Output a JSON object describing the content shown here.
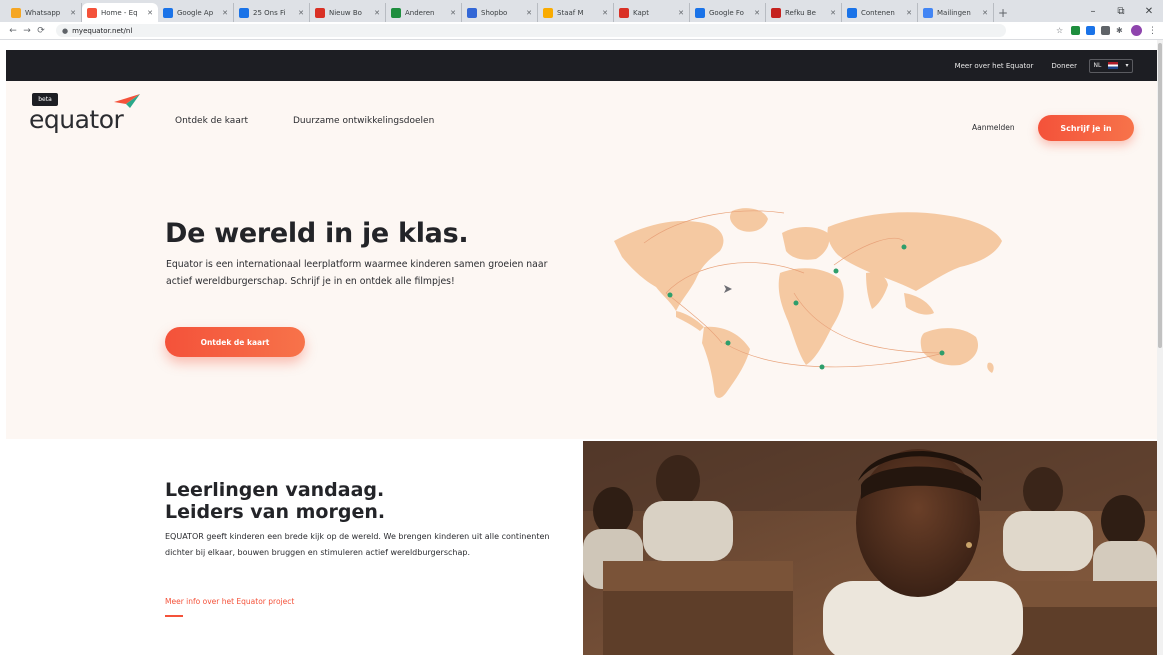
{
  "browser": {
    "tabs": [
      {
        "label": "Whatsapp",
        "color": "#f5a623"
      },
      {
        "label": "Home - Eq",
        "color": "#f4523a",
        "active": true
      },
      {
        "label": "Google Ap",
        "color": "#1a73e8"
      },
      {
        "label": "25 Ons Fi",
        "color": "#1a73e8"
      },
      {
        "label": "Nieuw Bo",
        "color": "#d93025"
      },
      {
        "label": "Anderen",
        "color": "#1e8e3e"
      },
      {
        "label": "Shopbo",
        "color": "#3367d6"
      },
      {
        "label": "Staaf M",
        "color": "#f9ab00"
      },
      {
        "label": "Kapt",
        "color": "#d93025"
      },
      {
        "label": "Google Fo",
        "color": "#1a73e8"
      },
      {
        "label": "Refku Be",
        "color": "#c5221f"
      },
      {
        "label": "Contenen",
        "color": "#1a73e8"
      },
      {
        "label": "Mailingen",
        "color": "#4285f4"
      }
    ],
    "url": "myequator.net/nl",
    "new_tab": "+",
    "window_controls": [
      "–",
      "⧉",
      "✕"
    ],
    "extension_colors": [
      "#1e8e3e",
      "#1a73e8",
      "#5f6368",
      "#5f6368"
    ]
  },
  "topbar": {
    "links": [
      "Meer over het Equator",
      "Doneer"
    ],
    "language": "NL"
  },
  "header": {
    "badge": "beta",
    "logo": "equator",
    "nav": [
      "Ontdek de kaart",
      "Duurzame ontwikkelingsdoelen"
    ],
    "login": "Aanmelden",
    "signup": "Schrijf je in"
  },
  "hero": {
    "title": "De wereld in je klas.",
    "text": "Equator is een internationaal leerplatform waarmee kinderen samen groeien naar actief wereldburgerschap. Schrijf je in en ontdek alle filmpjes!",
    "button": "Ontdek de kaart"
  },
  "section": {
    "title_line1": "Leerlingen vandaag.",
    "title_line2": "Leiders van morgen.",
    "text": "EQUATOR geeft kinderen een brede kijk op de wereld. We brengen kinderen uit alle continenten dichter bij elkaar, bouwen bruggen en stimuleren actief wereldburgerschap.",
    "link": "Meer info over het Equator project"
  },
  "colors": {
    "accent": "#f4523a",
    "map_land": "#f5c9a2",
    "map_marker": "#2e9e6b",
    "dark": "#1d1e23",
    "hero_bg": "#fdf7f3"
  }
}
